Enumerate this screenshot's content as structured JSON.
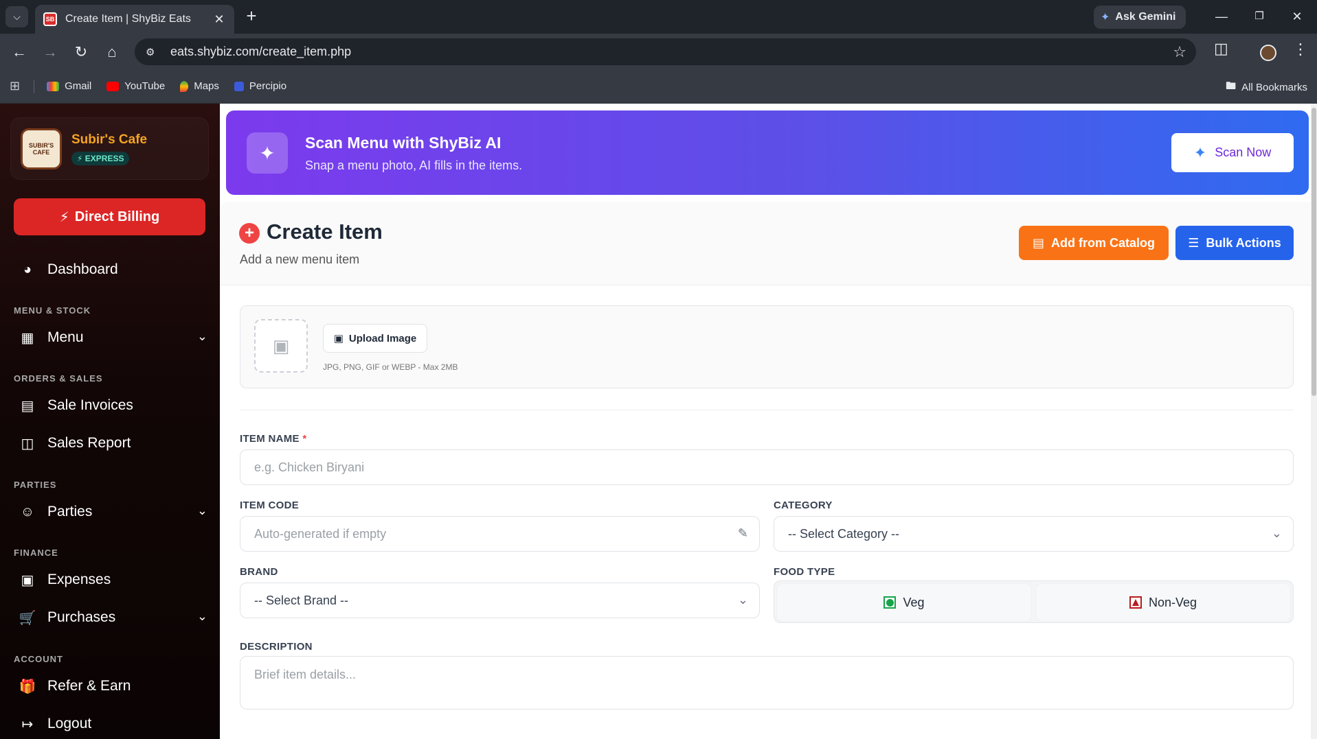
{
  "browser": {
    "tab_title": "Create Item | ShyBiz Eats",
    "tab_favicon_text": "SB",
    "ask_gemini": "Ask Gemini",
    "url": "eats.shybiz.com/create_item.php",
    "bookmarks": [
      "Gmail",
      "YouTube",
      "Maps",
      "Percipio"
    ],
    "all_bookmarks": "All Bookmarks"
  },
  "sidebar": {
    "brand_name": "Subir's Cafe",
    "brand_logo_text": "SUBIR'S CAFE",
    "brand_badge": "⚡ EXPRESS",
    "billing_button": "Direct Billing",
    "dashboard": "Dashboard",
    "sections": {
      "menu_stock": "MENU & STOCK",
      "orders_sales": "ORDERS & SALES",
      "parties": "PARTIES",
      "finance": "FINANCE",
      "account": "ACCOUNT"
    },
    "items": {
      "menu": "Menu",
      "sale_invoices": "Sale Invoices",
      "sales_report": "Sales Report",
      "parties": "Parties",
      "expenses": "Expenses",
      "purchases": "Purchases",
      "refer_earn": "Refer & Earn",
      "logout": "Logout"
    }
  },
  "scan_banner": {
    "title": "Scan Menu with ShyBiz AI",
    "subtitle": "Snap a menu photo, AI fills in the items.",
    "button": "Scan Now"
  },
  "header": {
    "title": "Create Item",
    "subtitle": "Add a new menu item",
    "catalog_button": "Add from Catalog",
    "bulk_button": "Bulk Actions"
  },
  "upload": {
    "button": "Upload Image",
    "hint": "JPG, PNG, GIF or WEBP - Max 2MB"
  },
  "form": {
    "item_name_label": "ITEM NAME",
    "item_name_required": "*",
    "item_name_placeholder": "e.g. Chicken Biryani",
    "item_code_label": "ITEM CODE",
    "item_code_placeholder": "Auto-generated if empty",
    "category_label": "CATEGORY",
    "category_value": "-- Select Category --",
    "brand_label": "BRAND",
    "brand_value": "-- Select Brand --",
    "food_type_label": "FOOD TYPE",
    "food_type_options": [
      "Veg",
      "Non-Veg"
    ],
    "description_label": "DESCRIPTION",
    "description_placeholder": "Brief item details..."
  },
  "colors": {
    "primary_red": "#dc2626",
    "brand_gold": "#f5a524",
    "banner_start": "#7c3aed",
    "banner_end": "#2f6bf0",
    "catalog_orange": "#f97316",
    "bulk_blue": "#2563eb",
    "veg_green": "#16a34a",
    "nonveg_red": "#b91c1c"
  }
}
